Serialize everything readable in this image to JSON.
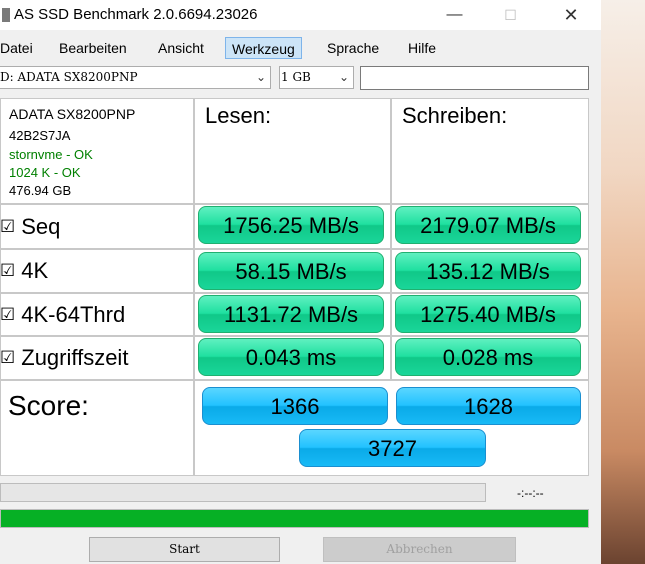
{
  "window": {
    "title": "AS SSD Benchmark 2.0.6694.23026",
    "minimize": "—",
    "maximize": "☐",
    "close": "✕"
  },
  "menu": [
    "Datei",
    "Bearbeiten",
    "Ansicht",
    "Werkzeug",
    "Sprache",
    "Hilfe"
  ],
  "menu_active": "Werkzeug",
  "toolbar": {
    "drive": "D: ADATA SX8200PNP",
    "size": "1 GB",
    "text": ""
  },
  "drive_info": {
    "model": "ADATA SX8200PNP",
    "firmware": "42B2S7JA",
    "driver_status": "stornvme - OK",
    "alignment_status": "1024 K - OK",
    "capacity": "476.94 GB",
    "ok_color": "#008000"
  },
  "headers": {
    "read": "Lesen:",
    "write": "Schreiben:"
  },
  "tests": [
    {
      "checkbox": "☑",
      "label": "Seq",
      "read": "1756.25 MB/s",
      "write": "2179.07 MB/s"
    },
    {
      "checkbox": "☑",
      "label": "4K",
      "read": "58.15 MB/s",
      "write": "135.12 MB/s"
    },
    {
      "checkbox": "☑",
      "label": "4K-64Thrd",
      "read": "1131.72 MB/s",
      "write": "1275.40 MB/s"
    },
    {
      "checkbox": "☑",
      "label": "Zugriffszeit",
      "read": "0.043 ms",
      "write": "0.028 ms"
    }
  ],
  "score": {
    "label": "Score:",
    "read": "1366",
    "write": "1628",
    "total": "3727"
  },
  "progress": {
    "elapsed": "-:--:--",
    "overall_fraction": 1.0,
    "bar_color": "#06b025"
  },
  "buttons": {
    "start": "Start",
    "abort": "Abbrechen"
  }
}
